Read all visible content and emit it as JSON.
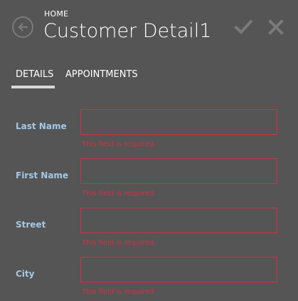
{
  "header": {
    "breadcrumb": "HOME",
    "title": "Customer Detail1",
    "back_icon": "back-arrow-icon",
    "save_icon": "checkmark-icon",
    "cancel_icon": "close-icon"
  },
  "tabs": [
    {
      "label": "DETAILS",
      "selected": true
    },
    {
      "label": "APPOINTMENTS",
      "selected": false
    }
  ],
  "fields": [
    {
      "label": "Last Name",
      "value": "",
      "error": "This field is required."
    },
    {
      "label": "First Name",
      "value": "",
      "error": "This field is required."
    },
    {
      "label": "Street",
      "value": "",
      "error": "This field is required."
    },
    {
      "label": "City",
      "value": "",
      "error": "This field is required."
    }
  ],
  "colors": {
    "background": "#555555",
    "label": "#a3c8e6",
    "error": "#d42f45",
    "icon": "#7a7a7a"
  }
}
